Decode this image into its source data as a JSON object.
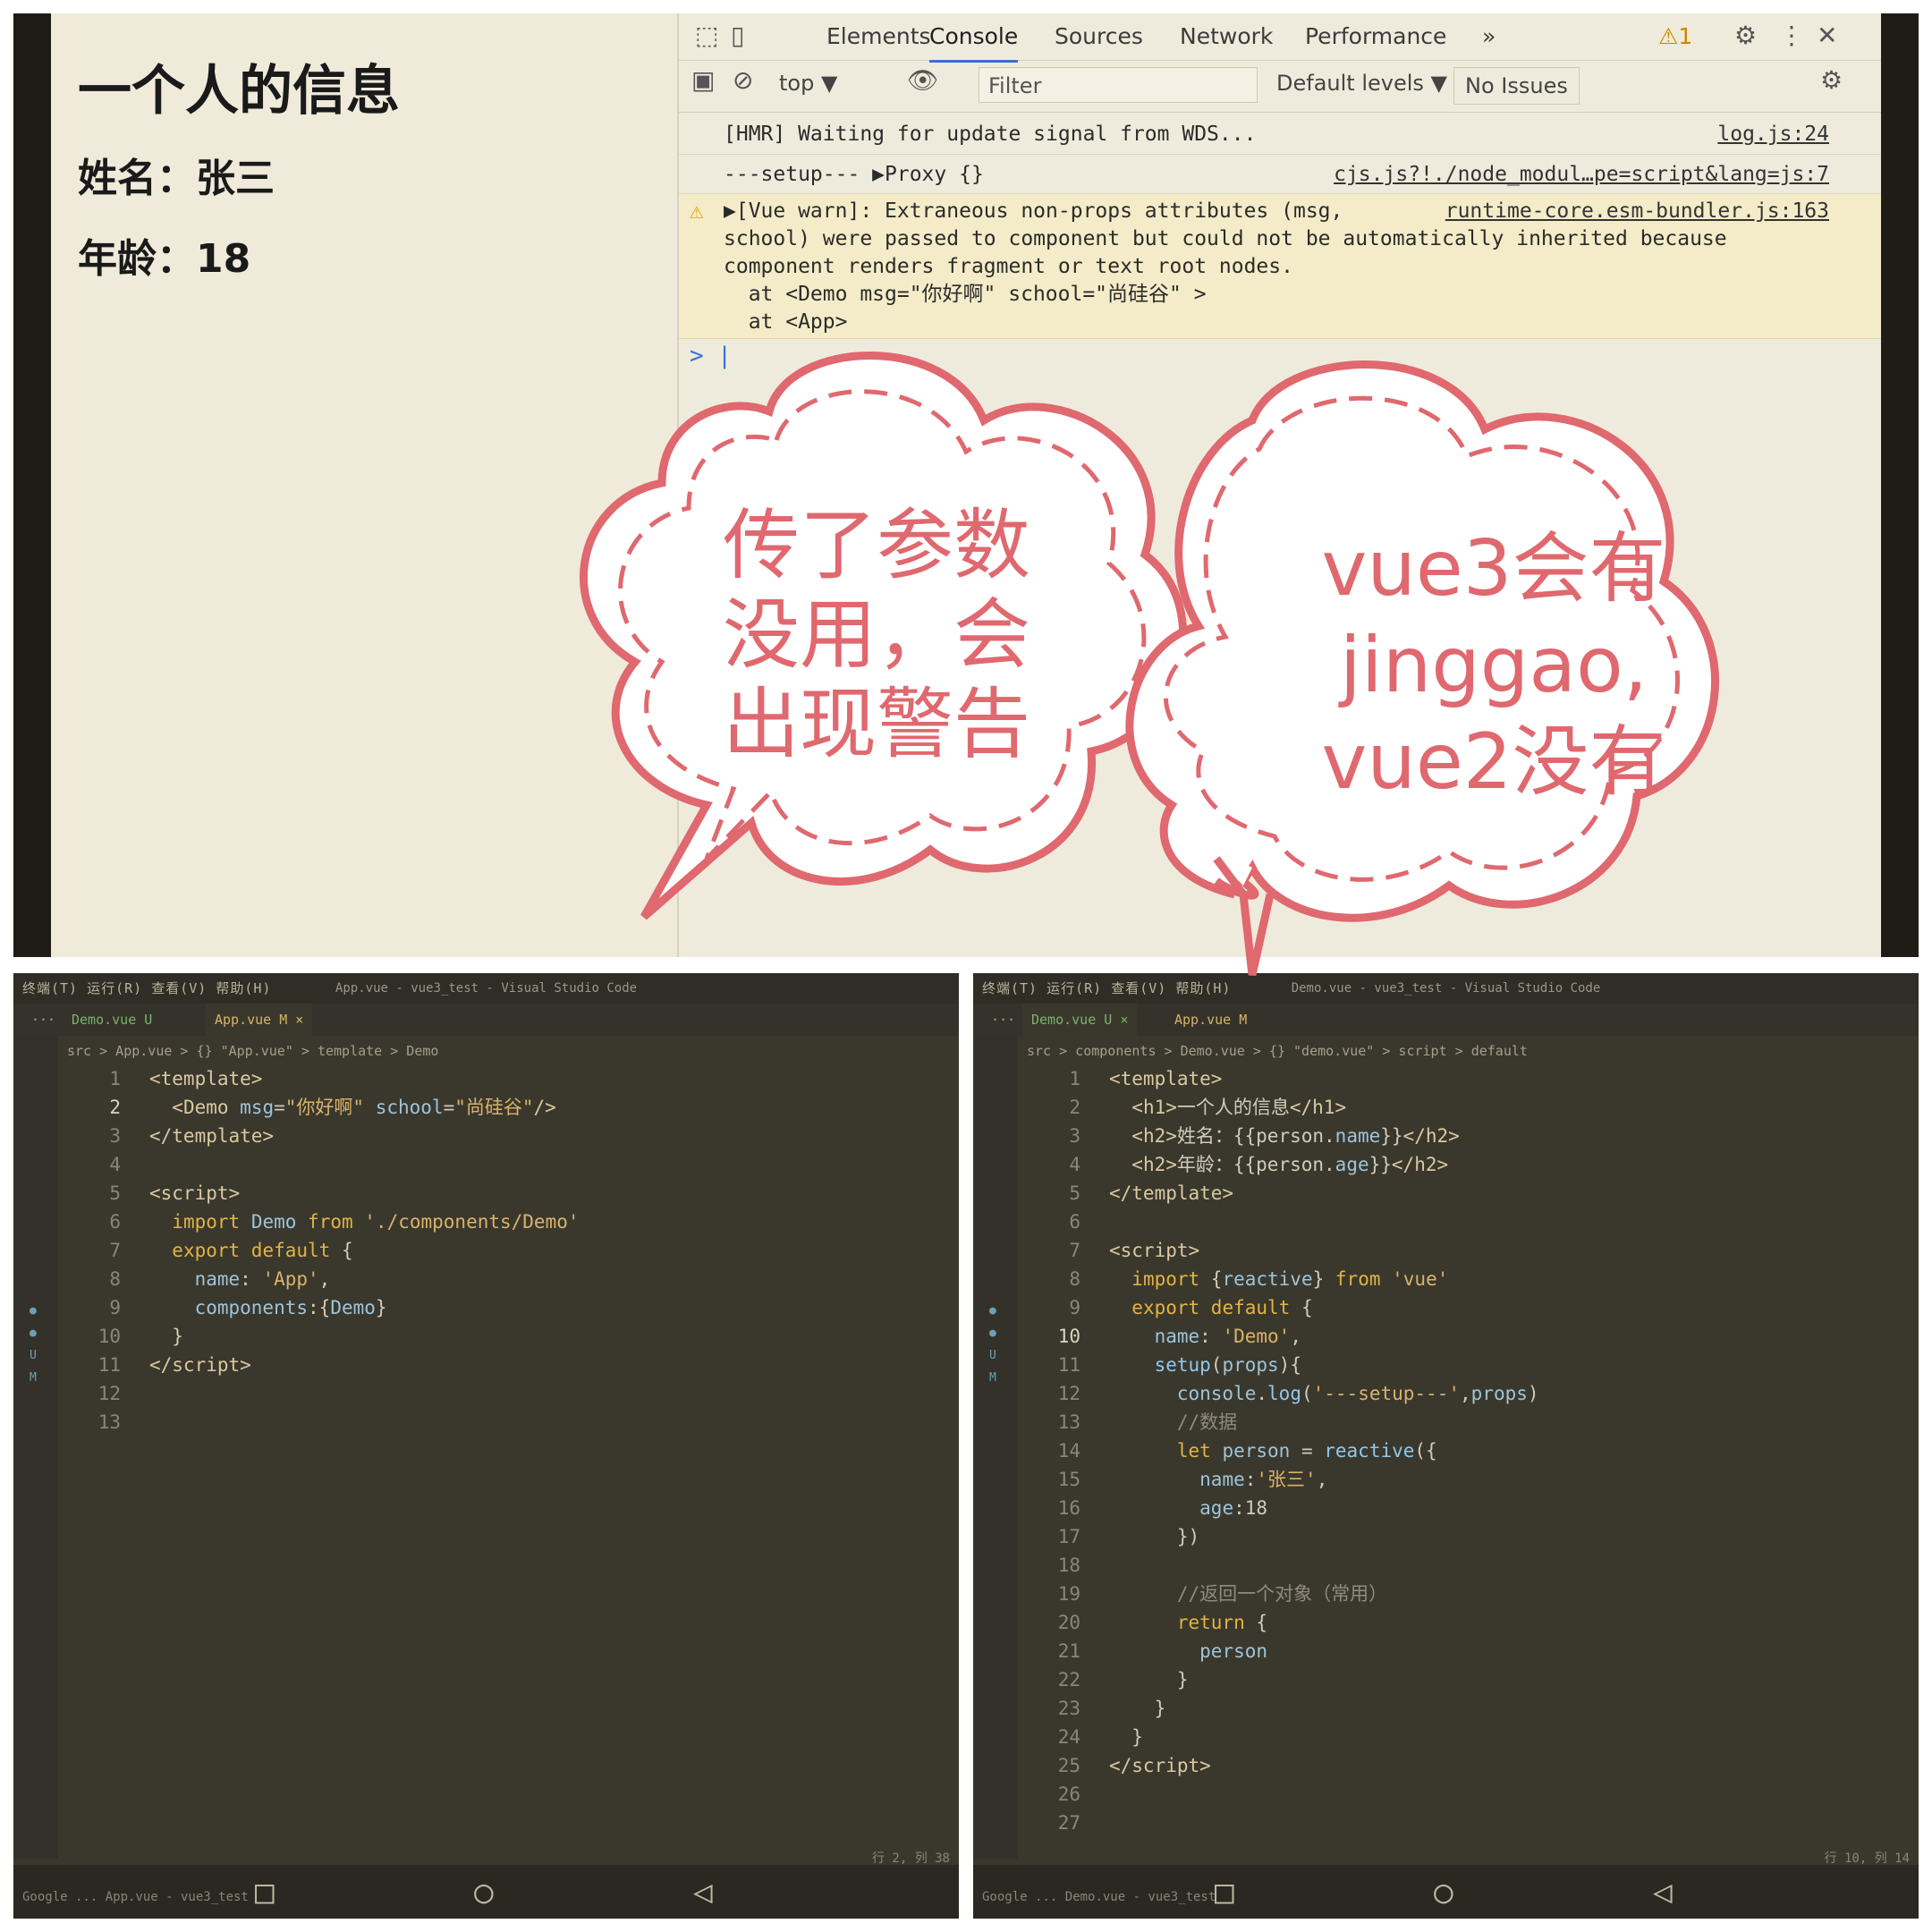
{
  "page": {
    "h1": "一个人的信息",
    "name_line": "姓名：张三",
    "age_line": "年龄：18"
  },
  "devtools": {
    "tabs": [
      "Elements",
      "Console",
      "Sources",
      "Network",
      "Performance"
    ],
    "more_tabs": "»",
    "warning_count": "⚠1",
    "context": "top ▼",
    "filter_placeholder": "Filter",
    "levels": "Default levels ▼",
    "issues": "No Issues",
    "lines": [
      {
        "msg": "[HMR] Waiting for update signal from WDS...",
        "src": "log.js:24"
      },
      {
        "msg": "---setup--- ▶Proxy {}",
        "src": "cjs.js?!./node_modul…pe=script&lang=js:7"
      }
    ],
    "warning": {
      "src": "runtime-core.esm-bundler.js:163",
      "text": "▶[Vue warn]: Extraneous non-props attributes (msg,\nschool) were passed to component but could not be automatically inherited because\ncomponent renders fragment or text root nodes.\n  at <Demo msg=\"你好啊\" school=\"尚硅谷\" >\n  at <App>"
    },
    "prompt": "> |"
  },
  "bubbles": {
    "left": [
      "传了参数",
      "没用，会",
      "出现警告"
    ],
    "right": [
      "vue3会有",
      "jinggao,",
      "vue2没有"
    ]
  },
  "colors": {
    "bubble_stroke": "#e0686f",
    "vscode_bg": "#3a382d",
    "devtools_bg": "#efebdc"
  },
  "vscode_left": {
    "menus": "终端(T)  运行(R)  查看(V)  帮助(H)",
    "title": "App.vue - vue3_test - Visual Studio Code",
    "tabs": [
      "Demo.vue U",
      "App.vue M ×"
    ],
    "breadcrumb": "src > App.vue > {} \"App.vue\" > template > Demo",
    "status": "行 2, 列 38",
    "taskbar": "Google ...   App.vue - vue3_test"
  },
  "vscode_right": {
    "menus": "终端(T)  运行(R)  查看(V)  帮助(H)",
    "title": "Demo.vue - vue3_test - Visual Studio Code",
    "tabs": [
      "Demo.vue U ×",
      "App.vue M"
    ],
    "breadcrumb": "src > components > Demo.vue > {} \"demo.vue\" > script > default",
    "status": "行 10, 列 14",
    "taskbar": "Google ...   Demo.vue - vue3_test"
  }
}
